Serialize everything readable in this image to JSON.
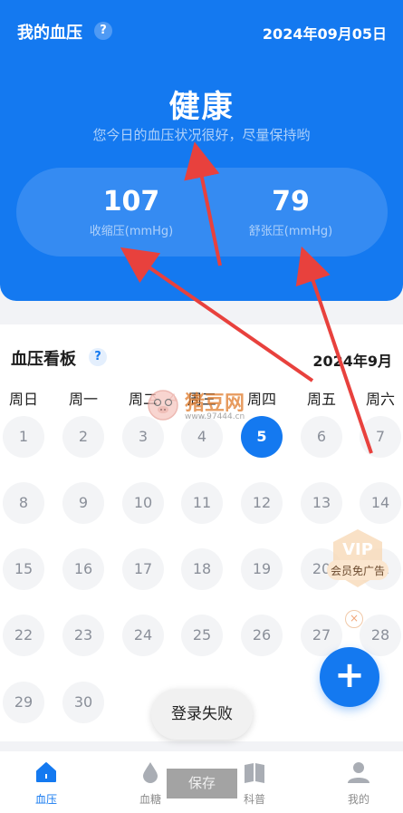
{
  "colors": {
    "primary": "#1479f0",
    "bg": "#f2f3f6",
    "day_bg": "#f3f4f6",
    "arrow": "#e8413d"
  },
  "header": {
    "title": "我的血压",
    "help_label": "?",
    "date": "2024年09月05日",
    "status": "健康",
    "status_desc": "您今日的血压状况很好，尽量保持哟",
    "systolic": {
      "value": "107",
      "label": "收缩压(mmHg)"
    },
    "diastolic": {
      "value": "79",
      "label": "舒张压(mmHg)"
    }
  },
  "board": {
    "title": "血压看板",
    "help_label": "?",
    "month": "2024年9月",
    "weekdays": [
      "周日",
      "周一",
      "周二",
      "周三",
      "周四",
      "周五",
      "周六"
    ],
    "days": [
      "1",
      "2",
      "3",
      "4",
      "5",
      "6",
      "7",
      "8",
      "9",
      "10",
      "11",
      "12",
      "13",
      "14",
      "15",
      "16",
      "17",
      "18",
      "19",
      "20",
      "21",
      "22",
      "23",
      "24",
      "25",
      "26",
      "27",
      "28",
      "29",
      "30"
    ],
    "selected_day": "5"
  },
  "toast": "登录失败",
  "fab_label": "+",
  "vip": {
    "title": "VIP",
    "subtitle": "会员免广告",
    "close": "×"
  },
  "watermark": {
    "text": "猪豆网",
    "url": "www.97444.cn"
  },
  "save_button": "保存",
  "tabs": [
    {
      "label": "血压",
      "icon": "home-icon",
      "active": true
    },
    {
      "label": "血糖",
      "icon": "drop-icon",
      "active": false
    },
    {
      "label": "科普",
      "icon": "book-icon",
      "active": false
    },
    {
      "label": "我的",
      "icon": "user-icon",
      "active": false
    }
  ]
}
